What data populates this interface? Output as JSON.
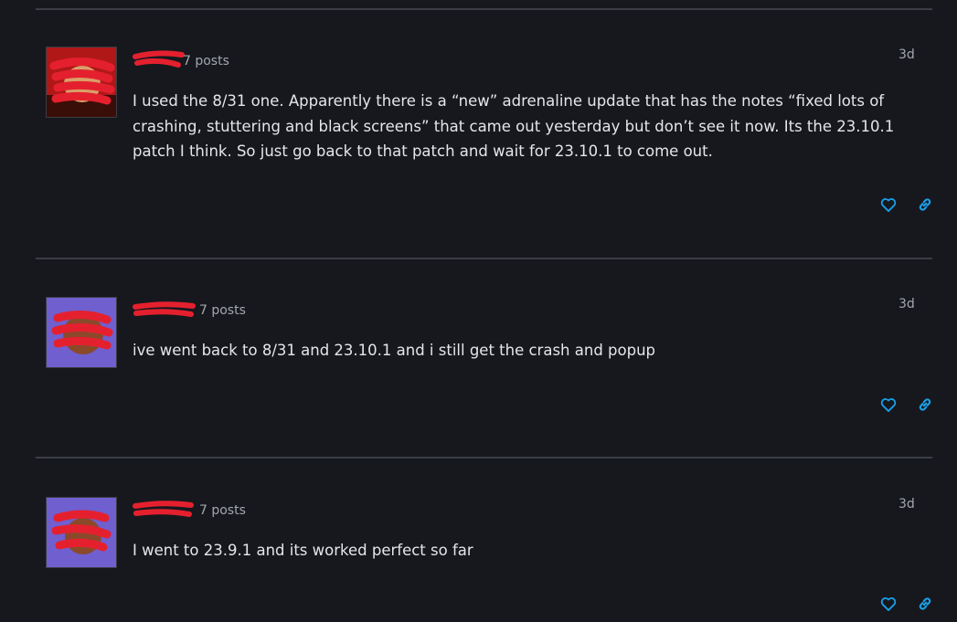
{
  "colors": {
    "background": "#16181d",
    "divider": "#3a3d44",
    "text": "#e4e6ea",
    "muted": "#a3a7ae",
    "accent": "#1a9fe8",
    "redaction": "#e5202e"
  },
  "posts": [
    {
      "post_count": "7 posts",
      "timestamp": "3d",
      "body": "I used the 8/31 one. Apparently there is a “new” adrenaline update that has the notes “fixed lots of crashing, stuttering and black screens” that came out yesterday but don’t see it now. Its the 23.10.1 patch I think. So just go back to that patch and wait for 23.10.1 to come out.",
      "avatar_style": "red",
      "icons": {
        "like": "heart-icon",
        "link": "link-icon"
      }
    },
    {
      "post_count": "7 posts",
      "timestamp": "3d",
      "body": "ive went back to 8/31 and 23.10.1 and i still get the crash and popup",
      "avatar_style": "purple",
      "icons": {
        "like": "heart-icon",
        "link": "link-icon"
      }
    },
    {
      "post_count": "7 posts",
      "timestamp": "3d",
      "body": "I went to 23.9.1 and its worked perfect so far",
      "avatar_style": "purple",
      "icons": {
        "like": "heart-icon",
        "link": "link-icon"
      }
    }
  ]
}
